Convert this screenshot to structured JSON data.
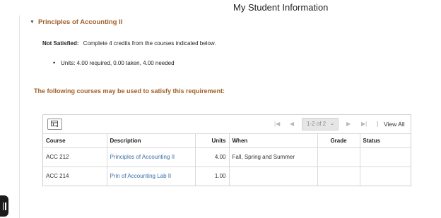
{
  "header": {
    "title": "My Student Information"
  },
  "section": {
    "title": "Principles of Accounting II",
    "status_label": "Not Satisfied:",
    "status_text": "Complete 4 credits from the courses indicated below.",
    "units_text": "Units: 4.00 required, 0.00 taken, 4.00 needed",
    "courses_heading": "The following courses may be used to satisfy this requirement:"
  },
  "grid": {
    "pagination": "1-2 of 2",
    "view_all": "View All",
    "columns": [
      "Course",
      "Description",
      "Units",
      "When",
      "Grade",
      "Status"
    ],
    "rows": [
      {
        "course": "ACC 212",
        "description": "Principles of Accounting II",
        "units": "4.00",
        "when": "Fall, Spring and Summer",
        "grade": "",
        "status": ""
      },
      {
        "course": "ACC 214",
        "description": "Prin of Accounting Lab II",
        "units": "1.00",
        "when": "",
        "grade": "",
        "status": ""
      }
    ]
  },
  "colors": {
    "accent": "#a0602a",
    "link": "#3a6ea5"
  },
  "icons": [
    "caret-down-icon",
    "personalize-grid-icon",
    "first-page-icon",
    "previous-page-icon",
    "next-page-icon",
    "last-page-icon",
    "side-handle-icon"
  ]
}
